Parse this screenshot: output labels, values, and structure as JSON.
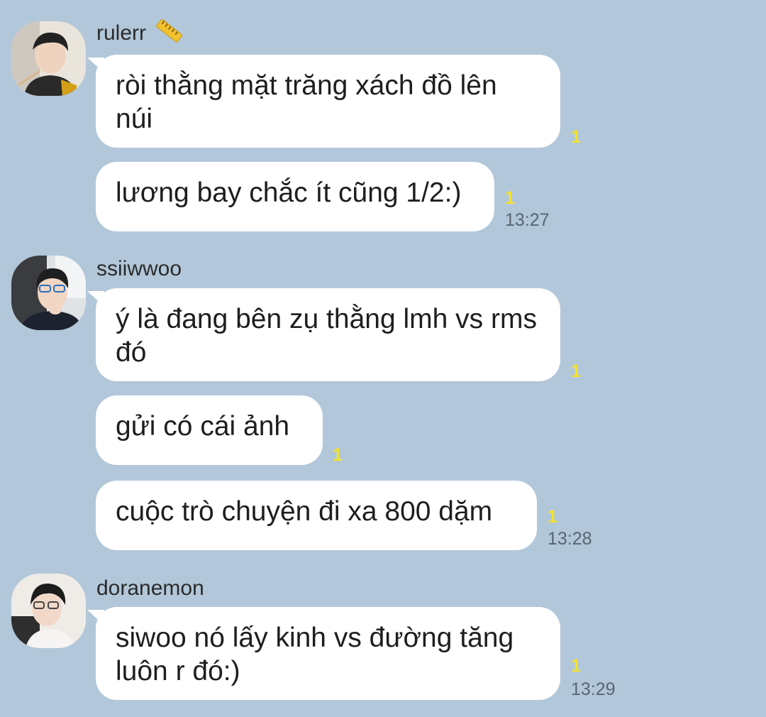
{
  "groups": [
    {
      "sender": "rulerr",
      "messages": [
        {
          "text": "ròi thằng mặt trăng xách đồ lên núi",
          "unread": "1",
          "time": ""
        },
        {
          "text": "lương bay chắc ít cũng 1/2:)",
          "unread": "1",
          "time": "13:27"
        }
      ]
    },
    {
      "sender": "ssiiwwoo",
      "messages": [
        {
          "text": "ý là đang bên zụ thằng lmh vs rms đó",
          "unread": "1",
          "time": ""
        },
        {
          "text": "gửi có cái ảnh",
          "unread": "1",
          "time": ""
        },
        {
          "text": "cuộc trò chuyện đi xa 800 dặm",
          "unread": "1",
          "time": "13:28"
        }
      ]
    },
    {
      "sender": "doranemon",
      "messages": [
        {
          "text": "siwoo nó lấy kinh vs đường tăng luôn r đó:)",
          "unread": "1",
          "time": "13:29"
        }
      ]
    }
  ],
  "colors": {
    "background": "#b2c7d9",
    "bubble": "#ffffff",
    "unread": "#f5e22a",
    "time": "#5a6571"
  },
  "icons": {
    "sender_badge": "ruler-emoji-icon"
  }
}
